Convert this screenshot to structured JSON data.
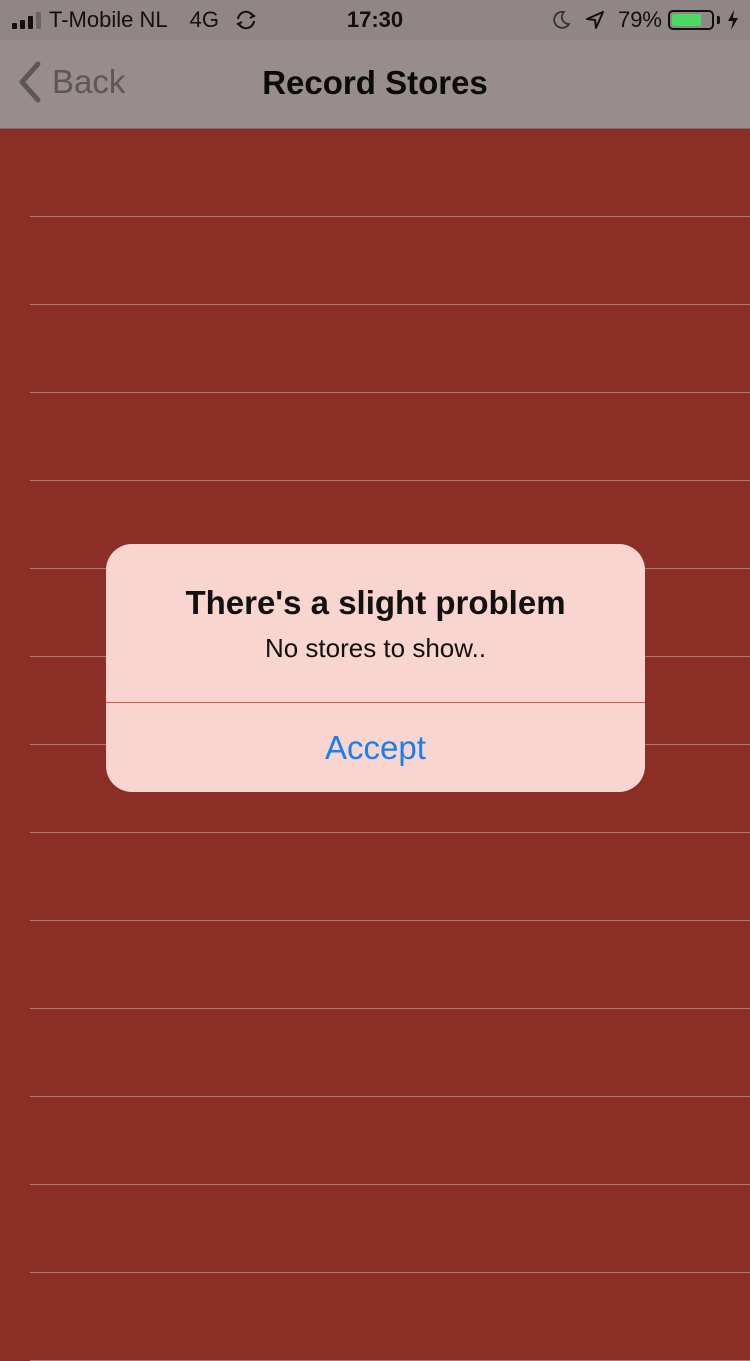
{
  "status_bar": {
    "carrier": "T-Mobile NL",
    "network": "4G",
    "time": "17:30",
    "battery_percent": "79%",
    "battery_level": 0.79,
    "signal_bars_active": 3,
    "signal_bars_total": 4,
    "icons": [
      "signal-icon",
      "sync-icon",
      "moon-icon",
      "location-icon",
      "battery-icon",
      "charging-bolt-icon"
    ]
  },
  "nav": {
    "back_label": "Back",
    "title": "Record Stores"
  },
  "list": {
    "row_count": 14
  },
  "alert": {
    "title": "There's a slight problem",
    "message": "No stores to show..",
    "button_label": "Accept"
  },
  "colors": {
    "background": "#8b2e25",
    "alert_background": "#f9d5cf",
    "accent": "#1a7ef0",
    "battery_green": "#4cd964"
  }
}
